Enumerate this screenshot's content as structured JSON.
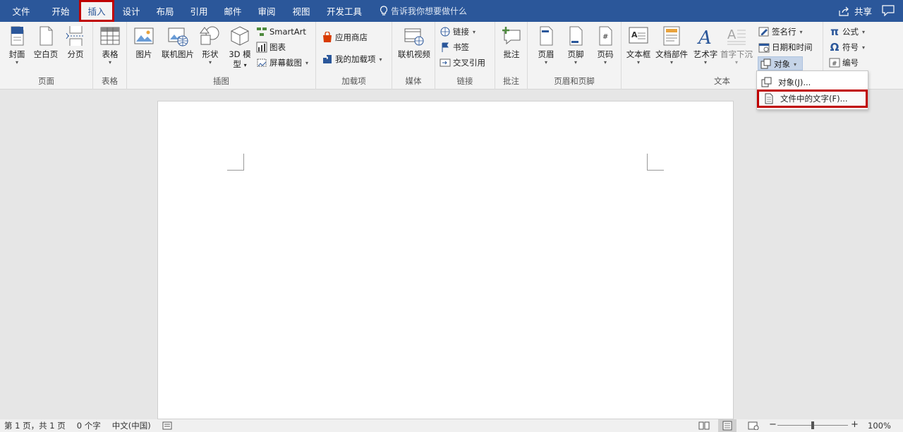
{
  "menu": {
    "tabs": [
      "文件",
      "开始",
      "插入",
      "设计",
      "布局",
      "引用",
      "邮件",
      "审阅",
      "视图",
      "开发工具"
    ],
    "active": "插入",
    "tell_me": "告诉我你想要做什么",
    "share": "共享"
  },
  "ribbon": {
    "pages": {
      "label": "页面",
      "cover": "封面",
      "blank": "空白页",
      "break": "分页"
    },
    "tables": {
      "label": "表格",
      "table": "表格"
    },
    "illustrations": {
      "label": "插图",
      "picture": "图片",
      "online_picture": "联机图片",
      "shapes": "形状",
      "model3d_line1": "3D 模",
      "model3d_line2": "型",
      "smartart": "SmartArt",
      "chart": "图表",
      "screenshot": "屏幕截图"
    },
    "addins": {
      "label": "加载项",
      "store": "应用商店",
      "my_addins": "我的加载项"
    },
    "media": {
      "label": "媒体",
      "online_video": "联机视频"
    },
    "links": {
      "label": "链接",
      "link": "链接",
      "bookmark": "书签",
      "cross_ref": "交叉引用"
    },
    "comments": {
      "label": "批注",
      "comment": "批注"
    },
    "header_footer": {
      "label": "页眉和页脚",
      "header": "页眉",
      "footer": "页脚",
      "page_number": "页码"
    },
    "text": {
      "label": "文本",
      "textbox": "文本框",
      "quickparts": "文档部件",
      "wordart": "艺术字",
      "dropcap": "首字下沉",
      "signature": "签名行",
      "datetime": "日期和时间",
      "object": "对象"
    },
    "symbols": {
      "equation": "公式",
      "symbol": "符号",
      "number": "编号"
    }
  },
  "dropdown": {
    "items": [
      "对象(J)...",
      "文件中的文字(F)..."
    ]
  },
  "status": {
    "page": "第 1 页，共 1 页",
    "words": "0 个字",
    "language": "中文(中国)",
    "zoom": "100%"
  },
  "colors": {
    "accent": "#2b579a",
    "highlight": "#c00000"
  }
}
